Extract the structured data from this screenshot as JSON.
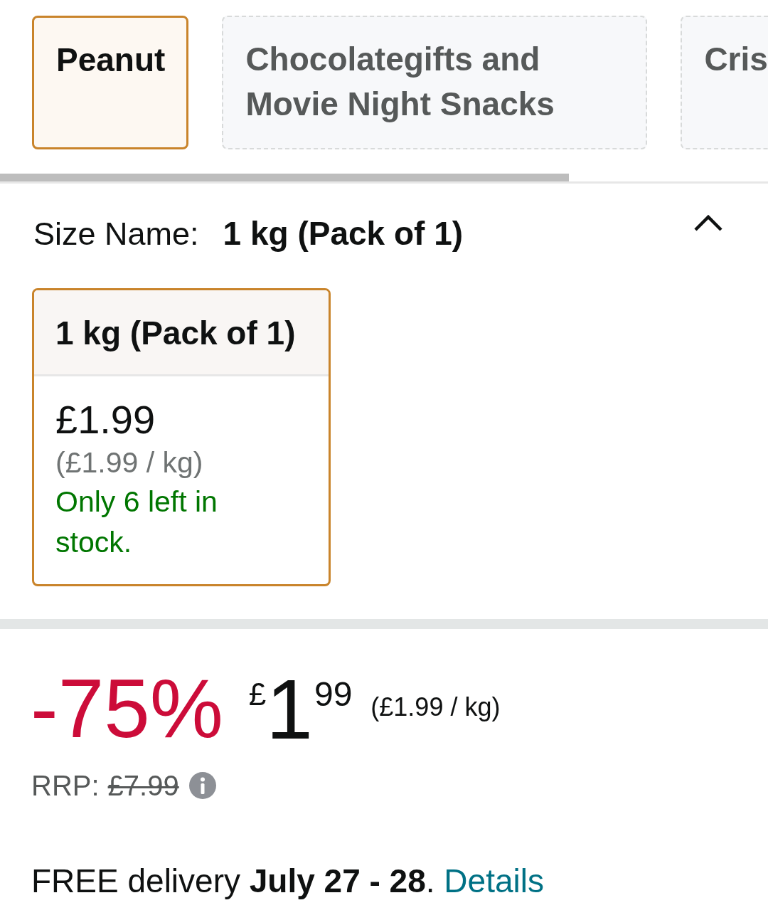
{
  "flavour_tabs": [
    {
      "label": "Peanut",
      "selected": true
    },
    {
      "label": "Chocolategifts and Movie Night Snacks",
      "selected": false
    },
    {
      "label": "Cris",
      "selected": false
    }
  ],
  "size_selector": {
    "label": "Size Name:",
    "value": "1 kg (Pack of 1)",
    "expanded": true,
    "options": [
      {
        "name": "1 kg (Pack of 1)",
        "price": "£1.99",
        "unit_price": "(£1.99 / kg)",
        "stock": "Only 6 left in stock.",
        "selected": true
      }
    ]
  },
  "price": {
    "discount": "-75%",
    "currency": "£",
    "whole": "1",
    "fraction": "99",
    "unit_price": "(£1.99 / kg)",
    "rrp_label": "RRP:",
    "rrp_value": "£7.99"
  },
  "delivery": {
    "text": "FREE delivery **July 27 - 28**.",
    "link": "Details"
  }
}
